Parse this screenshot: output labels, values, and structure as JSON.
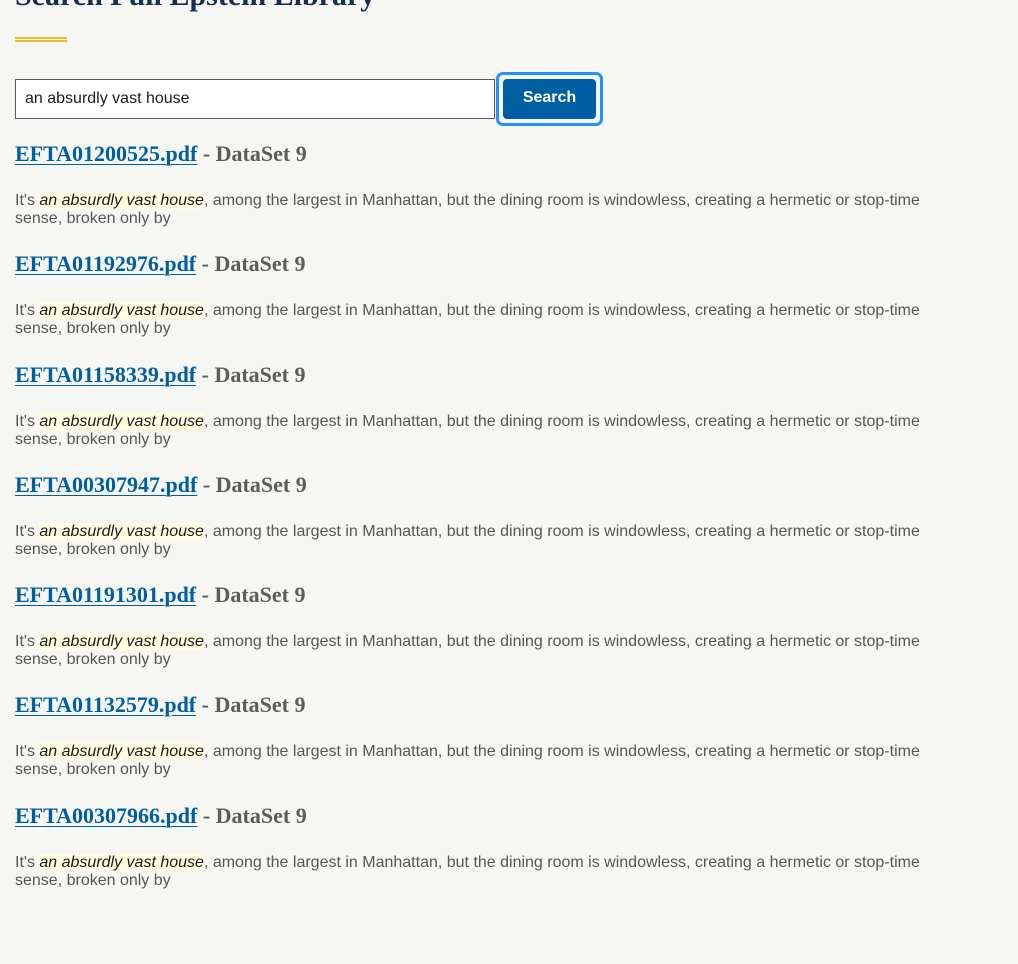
{
  "page": {
    "title": "Search Full Epstein Library"
  },
  "search": {
    "query": "an absurdly vast house",
    "button_label": "Search"
  },
  "results": [
    {
      "filename": "EFTA01200525.pdf",
      "separator": " - ",
      "dataset": "DataSet 9",
      "snippet_before": "It's ",
      "snippet_match": "an absurdly vast house",
      "snippet_after": ", among the largest in Manhattan, but the dining room is windowless, creating a hermetic or stop-time sense, broken only by"
    },
    {
      "filename": "EFTA01192976.pdf",
      "separator": " - ",
      "dataset": "DataSet 9",
      "snippet_before": "It's ",
      "snippet_match": "an absurdly vast house",
      "snippet_after": ", among the largest in Manhattan, but the dining room is windowless, creating a hermetic or stop-time sense, broken only by"
    },
    {
      "filename": "EFTA01158339.pdf",
      "separator": " - ",
      "dataset": "DataSet 9",
      "snippet_before": "It's ",
      "snippet_match": "an absurdly vast house",
      "snippet_after": ", among the largest in Manhattan, but the dining room is windowless, creating a hermetic or stop-time sense, broken only by"
    },
    {
      "filename": "EFTA00307947.pdf",
      "separator": " - ",
      "dataset": "DataSet 9",
      "snippet_before": "It's ",
      "snippet_match": "an absurdly vast house",
      "snippet_after": ", among the largest in Manhattan, but the dining room is windowless, creating a hermetic or stop-time sense, broken only by"
    },
    {
      "filename": "EFTA01191301.pdf",
      "separator": " - ",
      "dataset": "DataSet 9",
      "snippet_before": "It's ",
      "snippet_match": "an absurdly vast house",
      "snippet_after": ", among the largest in Manhattan, but the dining room is windowless, creating a hermetic or stop-time sense, broken only by"
    },
    {
      "filename": "EFTA01132579.pdf",
      "separator": " - ",
      "dataset": "DataSet 9",
      "snippet_before": "It's ",
      "snippet_match": "an absurdly vast house",
      "snippet_after": ", among the largest in Manhattan, but the dining room is windowless, creating a hermetic or stop-time sense, broken only by"
    },
    {
      "filename": "EFTA00307966.pdf",
      "separator": " - ",
      "dataset": "DataSet 9",
      "snippet_before": "It's ",
      "snippet_match": "an absurdly vast house",
      "snippet_after": ", among the largest in Manhattan, but the dining room is windowless, creating a hermetic or stop-time sense, broken only by"
    }
  ],
  "colors": {
    "background": "#f6f6f2",
    "title": "#162e51",
    "accent_rule": "#f2b632",
    "link": "#005ea2",
    "button_bg": "#005ea2",
    "focus_ring": "#2491ff",
    "highlight_bg": "#fffde0"
  }
}
